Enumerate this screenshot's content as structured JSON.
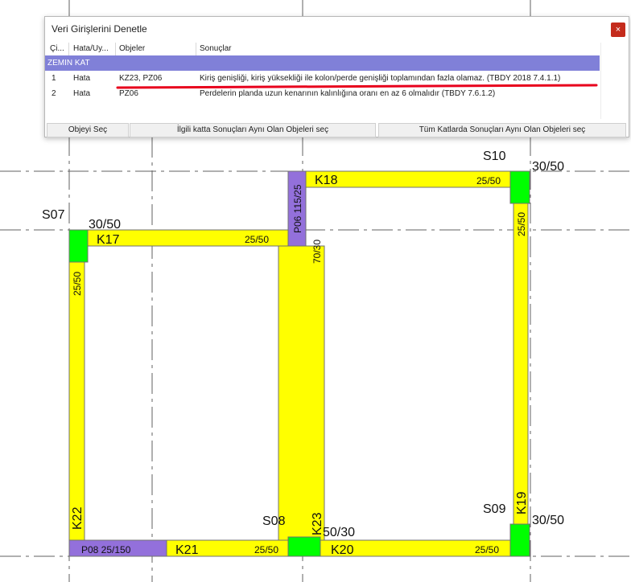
{
  "dialog": {
    "title": "Veri Girişlerini Denetle",
    "close_glyph": "×",
    "columns": [
      "Çi...",
      "Hata/Uy...",
      "Objeler",
      "Sonuçlar"
    ],
    "group": "ZEMIN KAT",
    "rows": [
      {
        "no": "1",
        "type": "Hata",
        "objects": "KZ23, PZ06",
        "result": "Kiriş genişliği, kiriş yüksekliği ile kolon/perde genişliği toplamından fazla olamaz. (TBDY 2018 7.4.1.1)"
      },
      {
        "no": "2",
        "type": "Hata",
        "objects": "PZ06",
        "result": "Perdelerin planda uzun kenarının kalınlığına oranı en az 6 olmalıdır (TBDY 7.6.1.2)"
      }
    ],
    "buttons": {
      "select_object": "Objeyi Seç",
      "select_same_floor": "İlgili katta Sonuçları Aynı Olan Objeleri seç",
      "select_all_floors": "Tüm Katlarda Sonuçları Aynı Olan Objeleri seç"
    },
    "highlight_color": "#e8001c"
  },
  "plan": {
    "colors": {
      "beam": "#ffff00",
      "column": "#00ff00",
      "wall": "#9370db",
      "outline": "#707070",
      "axis": "#606060"
    },
    "columns": [
      {
        "id": "S07",
        "size": "30/50"
      },
      {
        "id": "S10",
        "size": "30/50"
      },
      {
        "id": "S09",
        "size": "30/50"
      },
      {
        "id": "S08",
        "size": "50/30"
      }
    ],
    "beams": [
      {
        "id": "K17",
        "size": "25/50"
      },
      {
        "id": "K18",
        "size": "25/50"
      },
      {
        "id": "K19",
        "size": "25/50"
      },
      {
        "id": "K20",
        "size": "25/50"
      },
      {
        "id": "K21",
        "size": "25/50"
      },
      {
        "id": "K22",
        "size": "25/50"
      },
      {
        "id": "K23",
        "size": "70/30"
      }
    ],
    "walls": [
      {
        "label": "P06 115/25"
      },
      {
        "label": "P08 25/150"
      }
    ]
  }
}
